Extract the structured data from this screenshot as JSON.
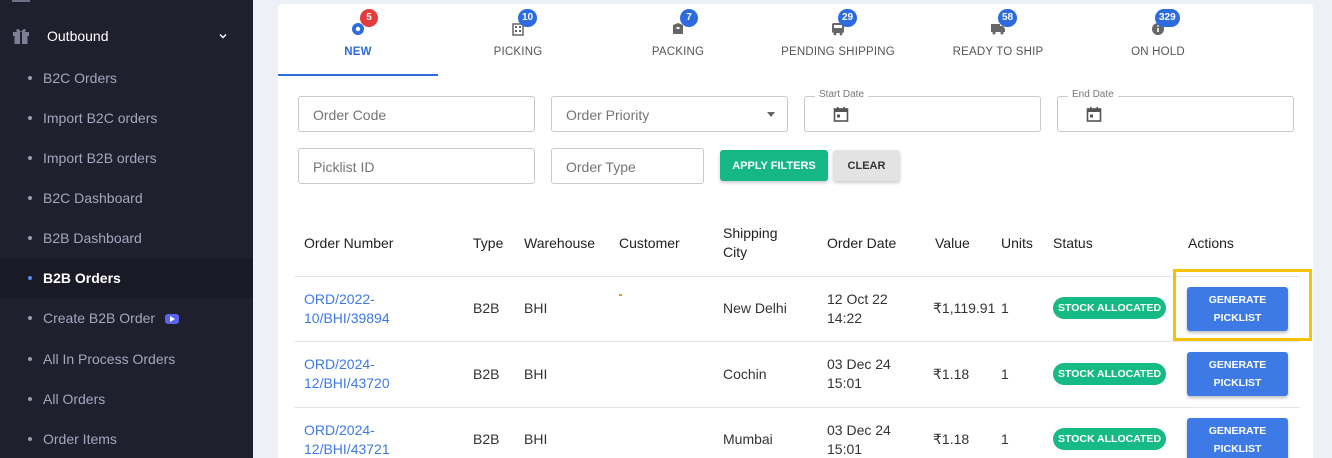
{
  "sidebar": {
    "section_label": "Outbound",
    "items": [
      {
        "label": "B2C Orders"
      },
      {
        "label": "Import B2C orders"
      },
      {
        "label": "Import B2B orders"
      },
      {
        "label": "B2C Dashboard"
      },
      {
        "label": "B2B Dashboard"
      },
      {
        "label": "B2B Orders"
      },
      {
        "label": "Create B2B Order"
      },
      {
        "label": "All In Process Orders"
      },
      {
        "label": "All Orders"
      },
      {
        "label": "Order Items"
      }
    ],
    "active_item": "B2B Orders"
  },
  "tabs": [
    {
      "label": "NEW",
      "count": "5",
      "icon": "gear-badge-icon",
      "active": true
    },
    {
      "label": "PICKING",
      "count": "10",
      "icon": "building-icon"
    },
    {
      "label": "PACKING",
      "count": "7",
      "icon": "package-icon"
    },
    {
      "label": "PENDING SHIPPING",
      "count": "29",
      "icon": "bus-icon"
    },
    {
      "label": "READY TO SHIP",
      "count": "58",
      "icon": "truck-icon"
    },
    {
      "label": "ON HOLD",
      "count": "329",
      "icon": "info-icon"
    }
  ],
  "filters": {
    "order_code_placeholder": "Order Code",
    "order_priority_placeholder": "Order Priority",
    "start_date_label": "Start Date",
    "end_date_label": "End Date",
    "picklist_id_placeholder": "Picklist ID",
    "order_type_placeholder": "Order Type",
    "apply_label": "APPLY FILTERS",
    "clear_label": "CLEAR"
  },
  "table": {
    "headers": {
      "order_number": "Order Number",
      "type": "Type",
      "warehouse": "Warehouse",
      "customer": "Customer",
      "shipping_city_1": "Shipping",
      "shipping_city_2": "City",
      "order_date": "Order Date",
      "value": "Value",
      "units": "Units",
      "status": "Status",
      "actions": "Actions"
    },
    "rows": [
      {
        "order_1": "ORD/2022-",
        "order_2": "10/BHI/39894",
        "type": "B2B",
        "warehouse": "BHI",
        "customer": "",
        "city": "New Delhi",
        "date_1": "12 Oct 22",
        "date_2": "14:22",
        "value": "₹1,119.91",
        "units": "1",
        "status": "STOCK ALLOCATED",
        "action_1": "GENERATE",
        "action_2": "PICKLIST"
      },
      {
        "order_1": "ORD/2024-",
        "order_2": "12/BHI/43720",
        "type": "B2B",
        "warehouse": "BHI",
        "customer": "",
        "city": "Cochin",
        "date_1": "03 Dec 24",
        "date_2": "15:01",
        "value": "₹1.18",
        "units": "1",
        "status": "STOCK ALLOCATED",
        "action_1": "GENERATE",
        "action_2": "PICKLIST"
      },
      {
        "order_1": "ORD/2024-",
        "order_2": "12/BHI/43721",
        "type": "B2B",
        "warehouse": "BHI",
        "customer": "",
        "city": "Mumbai",
        "date_1": "03 Dec 24",
        "date_2": "15:01",
        "value": "₹1.18",
        "units": "1",
        "status": "STOCK ALLOCATED",
        "action_1": "GENERATE",
        "action_2": "PICKLIST"
      }
    ]
  },
  "colors": {
    "sidebar_bg": "#1f1f2e",
    "accent_blue": "#2d6cdf",
    "status_green": "#16ba85",
    "highlight_yellow": "#f4c300",
    "badge_red": "#e23c3c"
  }
}
